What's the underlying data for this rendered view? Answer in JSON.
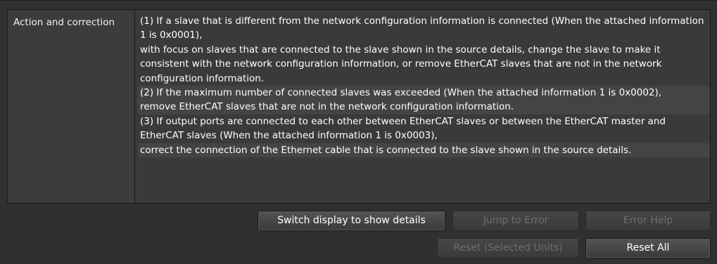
{
  "table": {
    "label": "Action and correction",
    "paragraphs": [
      "(1) If a slave that is different from the network configuration information is connected (When the attached information 1 is 0x0001),",
      "with focus on slaves that are connected to the slave shown in the source details, change the slave to make it consistent with the network configuration information, or remove EtherCAT slaves that are not in the network configuration information.",
      "(2) If the maximum number of connected slaves was exceeded (When the attached information 1 is 0x0002),",
      "remove EtherCAT slaves that are not in the network configuration information.",
      "(3) If output ports are connected to each other between EtherCAT slaves or between the EtherCAT master and EtherCAT slaves (When the attached information 1 is 0x0003),",
      "correct the connection of the Ethernet cable that is connected to the slave shown in the source details."
    ]
  },
  "buttons": {
    "switch_display": "Switch display to show details",
    "jump_to_error": "Jump to Error",
    "error_help": "Error Help",
    "reset_selected": "Reset (Selected Units)",
    "reset_all": "Reset All"
  },
  "colors": {
    "background": "#303030",
    "button_enabled_text": "#ffffff",
    "button_disabled_text": "#6d6d6d"
  }
}
